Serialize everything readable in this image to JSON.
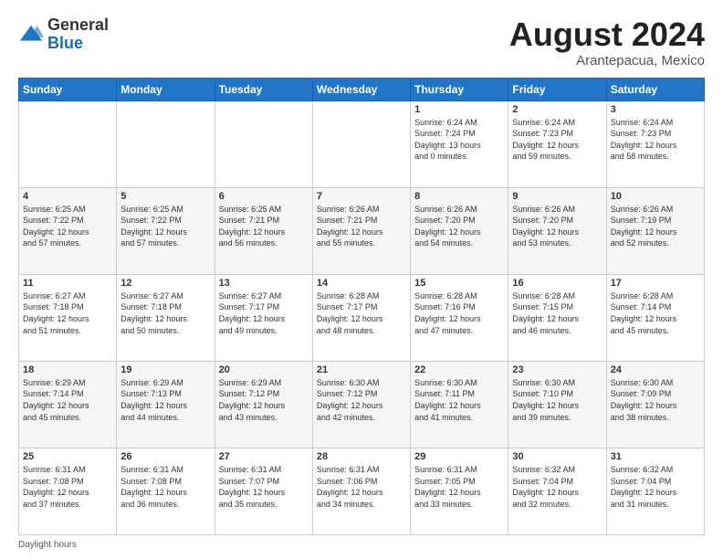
{
  "header": {
    "logo_general": "General",
    "logo_blue": "Blue",
    "month_year": "August 2024",
    "location": "Arantepacua, Mexico"
  },
  "footer": {
    "daylight_label": "Daylight hours"
  },
  "days_of_week": [
    "Sunday",
    "Monday",
    "Tuesday",
    "Wednesday",
    "Thursday",
    "Friday",
    "Saturday"
  ],
  "weeks": [
    [
      {
        "day": "",
        "info": ""
      },
      {
        "day": "",
        "info": ""
      },
      {
        "day": "",
        "info": ""
      },
      {
        "day": "",
        "info": ""
      },
      {
        "day": "1",
        "info": "Sunrise: 6:24 AM\nSunset: 7:24 PM\nDaylight: 13 hours\nand 0 minutes."
      },
      {
        "day": "2",
        "info": "Sunrise: 6:24 AM\nSunset: 7:23 PM\nDaylight: 12 hours\nand 59 minutes."
      },
      {
        "day": "3",
        "info": "Sunrise: 6:24 AM\nSunset: 7:23 PM\nDaylight: 12 hours\nand 58 minutes."
      }
    ],
    [
      {
        "day": "4",
        "info": "Sunrise: 6:25 AM\nSunset: 7:22 PM\nDaylight: 12 hours\nand 57 minutes."
      },
      {
        "day": "5",
        "info": "Sunrise: 6:25 AM\nSunset: 7:22 PM\nDaylight: 12 hours\nand 57 minutes."
      },
      {
        "day": "6",
        "info": "Sunrise: 6:25 AM\nSunset: 7:21 PM\nDaylight: 12 hours\nand 56 minutes."
      },
      {
        "day": "7",
        "info": "Sunrise: 6:26 AM\nSunset: 7:21 PM\nDaylight: 12 hours\nand 55 minutes."
      },
      {
        "day": "8",
        "info": "Sunrise: 6:26 AM\nSunset: 7:20 PM\nDaylight: 12 hours\nand 54 minutes."
      },
      {
        "day": "9",
        "info": "Sunrise: 6:26 AM\nSunset: 7:20 PM\nDaylight: 12 hours\nand 53 minutes."
      },
      {
        "day": "10",
        "info": "Sunrise: 6:26 AM\nSunset: 7:19 PM\nDaylight: 12 hours\nand 52 minutes."
      }
    ],
    [
      {
        "day": "11",
        "info": "Sunrise: 6:27 AM\nSunset: 7:18 PM\nDaylight: 12 hours\nand 51 minutes."
      },
      {
        "day": "12",
        "info": "Sunrise: 6:27 AM\nSunset: 7:18 PM\nDaylight: 12 hours\nand 50 minutes."
      },
      {
        "day": "13",
        "info": "Sunrise: 6:27 AM\nSunset: 7:17 PM\nDaylight: 12 hours\nand 49 minutes."
      },
      {
        "day": "14",
        "info": "Sunrise: 6:28 AM\nSunset: 7:17 PM\nDaylight: 12 hours\nand 48 minutes."
      },
      {
        "day": "15",
        "info": "Sunrise: 6:28 AM\nSunset: 7:16 PM\nDaylight: 12 hours\nand 47 minutes."
      },
      {
        "day": "16",
        "info": "Sunrise: 6:28 AM\nSunset: 7:15 PM\nDaylight: 12 hours\nand 46 minutes."
      },
      {
        "day": "17",
        "info": "Sunrise: 6:28 AM\nSunset: 7:14 PM\nDaylight: 12 hours\nand 45 minutes."
      }
    ],
    [
      {
        "day": "18",
        "info": "Sunrise: 6:29 AM\nSunset: 7:14 PM\nDaylight: 12 hours\nand 45 minutes."
      },
      {
        "day": "19",
        "info": "Sunrise: 6:29 AM\nSunset: 7:13 PM\nDaylight: 12 hours\nand 44 minutes."
      },
      {
        "day": "20",
        "info": "Sunrise: 6:29 AM\nSunset: 7:12 PM\nDaylight: 12 hours\nand 43 minutes."
      },
      {
        "day": "21",
        "info": "Sunrise: 6:30 AM\nSunset: 7:12 PM\nDaylight: 12 hours\nand 42 minutes."
      },
      {
        "day": "22",
        "info": "Sunrise: 6:30 AM\nSunset: 7:11 PM\nDaylight: 12 hours\nand 41 minutes."
      },
      {
        "day": "23",
        "info": "Sunrise: 6:30 AM\nSunset: 7:10 PM\nDaylight: 12 hours\nand 39 minutes."
      },
      {
        "day": "24",
        "info": "Sunrise: 6:30 AM\nSunset: 7:09 PM\nDaylight: 12 hours\nand 38 minutes."
      }
    ],
    [
      {
        "day": "25",
        "info": "Sunrise: 6:31 AM\nSunset: 7:08 PM\nDaylight: 12 hours\nand 37 minutes."
      },
      {
        "day": "26",
        "info": "Sunrise: 6:31 AM\nSunset: 7:08 PM\nDaylight: 12 hours\nand 36 minutes."
      },
      {
        "day": "27",
        "info": "Sunrise: 6:31 AM\nSunset: 7:07 PM\nDaylight: 12 hours\nand 35 minutes."
      },
      {
        "day": "28",
        "info": "Sunrise: 6:31 AM\nSunset: 7:06 PM\nDaylight: 12 hours\nand 34 minutes."
      },
      {
        "day": "29",
        "info": "Sunrise: 6:31 AM\nSunset: 7:05 PM\nDaylight: 12 hours\nand 33 minutes."
      },
      {
        "day": "30",
        "info": "Sunrise: 6:32 AM\nSunset: 7:04 PM\nDaylight: 12 hours\nand 32 minutes."
      },
      {
        "day": "31",
        "info": "Sunrise: 6:32 AM\nSunset: 7:04 PM\nDaylight: 12 hours\nand 31 minutes."
      }
    ]
  ]
}
